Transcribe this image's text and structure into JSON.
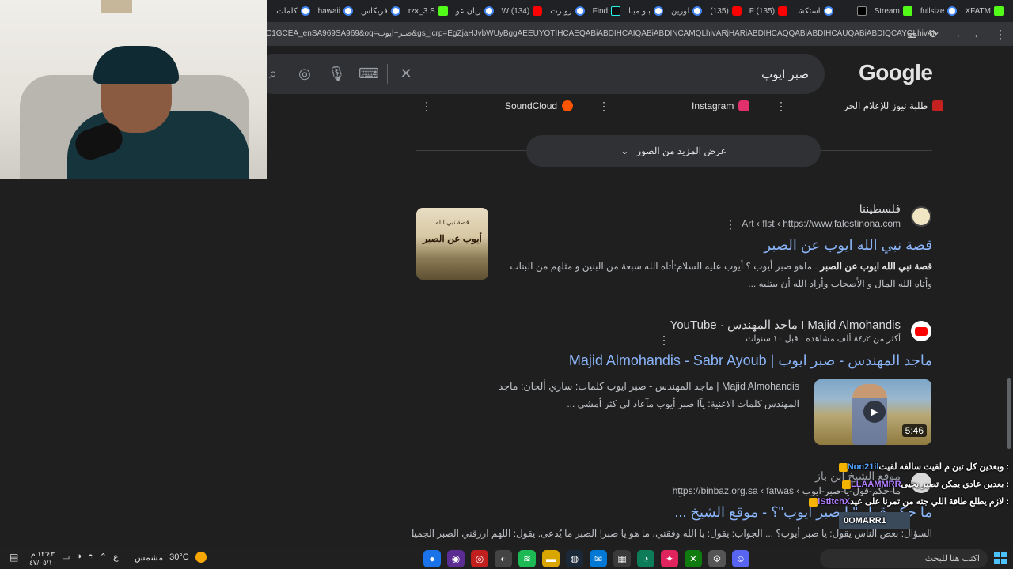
{
  "browser": {
    "tabs": [
      {
        "label": "XFATM",
        "icon": "kick"
      },
      {
        "label": "fullsize",
        "icon": "g"
      },
      {
        "label": "Stream",
        "icon": "kick"
      },
      {
        "label": "",
        "icon": "x"
      },
      {
        "label": "استكشـ",
        "icon": "g"
      },
      {
        "label": "(135) F",
        "icon": "yt"
      },
      {
        "label": "(135)",
        "icon": "yt"
      },
      {
        "label": "لورين",
        "icon": "g"
      },
      {
        "label": "باو مينا",
        "icon": "g"
      },
      {
        "label": "Find",
        "icon": "tt"
      },
      {
        "label": "روبرت",
        "icon": "g"
      },
      {
        "label": "(134) W",
        "icon": "yt"
      },
      {
        "label": "ريان عو",
        "icon": "g"
      },
      {
        "label": "rzx_3 S",
        "icon": "kick"
      },
      {
        "label": "فريكاس",
        "icon": "g"
      },
      {
        "label": "hawaii",
        "icon": "g"
      },
      {
        "label": "كلمات",
        "icon": "g"
      }
    ],
    "url": "C1GCEA_enSA969SA969&oq=صبر+ايوب&gs_lcrp=EgZjaHJvbWUyBggAEEUYOTIHCAEQABiABDIHCAIQABiABDINCAMQLhivARjHARiABDIHCAQQABiABDIHCAUQABiABDIQCAYQLhivARjHARiABBiOBTIHCAc"
  },
  "google": {
    "logo_text": "Google",
    "query": "صبر ايوب"
  },
  "sources": [
    {
      "label": "طلبة نيوز للإعلام الحر",
      "color": "#c5221f"
    },
    {
      "label": "Instagram",
      "color": "#e1306c"
    },
    {
      "label": "SoundCloud",
      "color": "#ff5500"
    }
  ],
  "more_images_label": "عرض المزيد من الصور",
  "results": [
    {
      "site_name": "فلسطيننا",
      "site_url": "Art ‹ flst ‹ https://www.falestinona.com",
      "title": "قصة نبي الله ايوب عن الصبر",
      "snippet_bold": "قصة نبي الله ايوب عن الصبر",
      "snippet_rest": " ـ ماهو صبر أيوب ؟ أيوب عليه السلام:أتاه الله سبعة من البنين و مثلهم من البنات وأتاه الله المال و الأصحاب وأراد الله أن يبتليه ...",
      "thumb_small": "قصة نبي الله",
      "thumb_big": "أيوب عن الصبر"
    },
    {
      "site_name": "YouTube · ماجد المهندس I Majid Almohandis",
      "site_url": "أكثر من ٨٤٫٢ ألف مشاهدة · قبل ١٠ سنوات",
      "title": "Majid Almohandis - Sabr Ayoub | ماجد المهندس - صبر ايوب",
      "snippet_line1": "Majid Almohandis | ماجد المهندس - صبر ايوب كلمات: ساري ألحان: ماجد",
      "snippet_line2": "المهندس كلمات الاغنية: يآا صبر أيوب مآعاد لي كثر أمشي ...",
      "duration": "5:46"
    },
    {
      "site_name": "موقع الشيخ ابن باز",
      "site_url": "https://binbaz.org.sa ‹ fatwas ‹ ما-حكم-قول-يا-صبر-ايوب",
      "title": "ما حكم قول \"يا صبر أيوب\"؟ - موقع الشيخ ...",
      "snippet": "السؤال: بعض الناس يقول: يا صبر أيوب؟ ... الجواب: يقول: يا الله وفقني، ما هو يا صبر! الصبر ما يُدعى. يقول: اللهم ارزقني الصبر الجميل، هذا"
    }
  ],
  "chat": [
    {
      "user": "Non21il",
      "text": ": وبعدين كل تبن م لقيت سالفه لقيت",
      "user_color": "blue"
    },
    {
      "user": "LLAAMMRR",
      "text": ": بعدين عادي يمكن تصير يحيى",
      "user_color": "purple"
    },
    {
      "user": "iStitchX",
      "text": ": لازم يطلع طاقة اللي جته من تمرنا على عيد",
      "user_color": "purple"
    }
  ],
  "chat_extra": "0OMARR1",
  "taskbar": {
    "search_placeholder": "اكتب هنا للبحث",
    "weather_temp": "30°C",
    "weather_text": "مشمس",
    "time": "١٢:٤٣ م",
    "date": "٤٧/٠٥/١٠",
    "lang": "ع"
  }
}
